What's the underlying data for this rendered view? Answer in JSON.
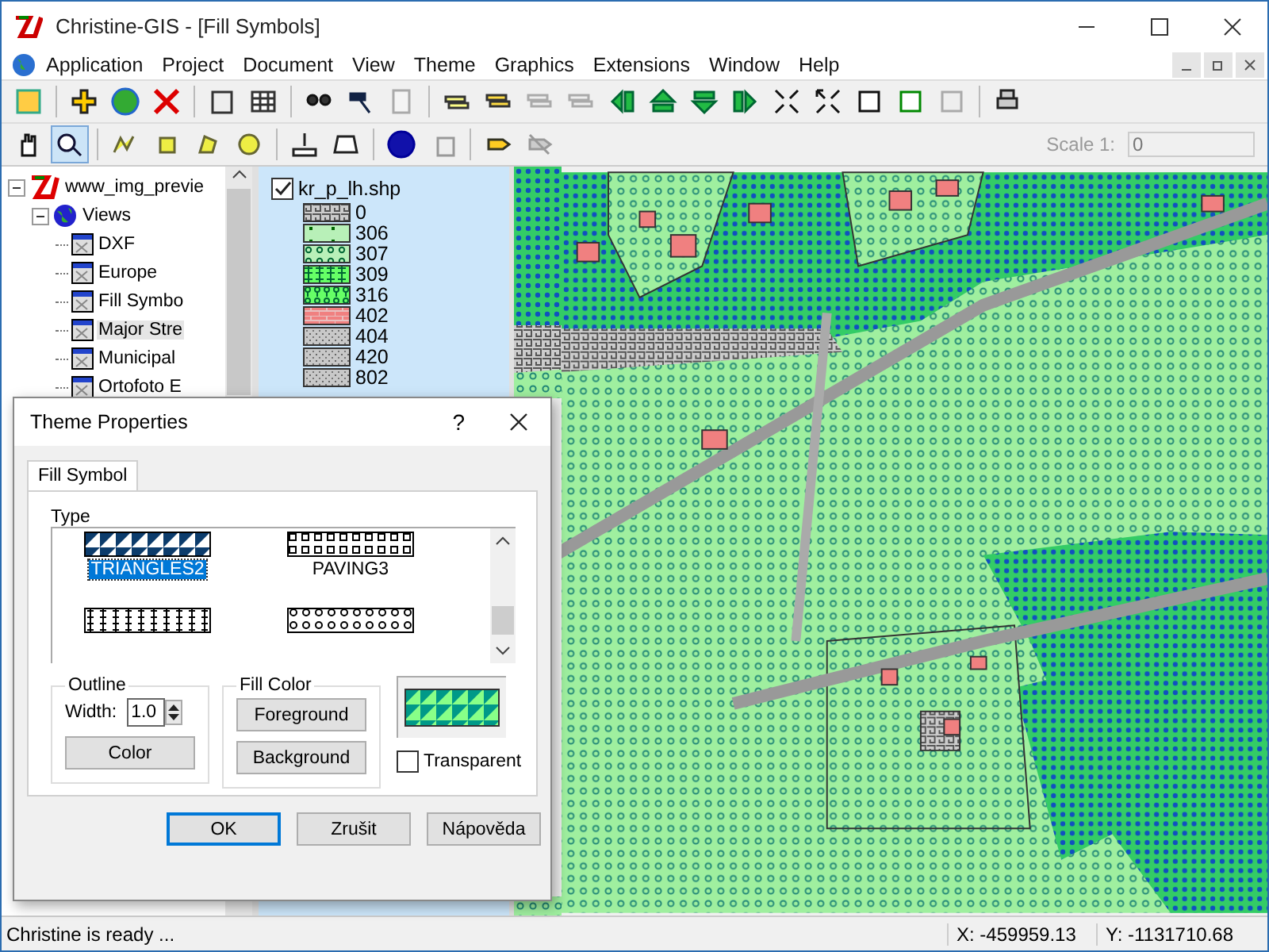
{
  "window": {
    "title": "Christine-GIS - [Fill Symbols]"
  },
  "menu": [
    "Application",
    "Project",
    "Document",
    "View",
    "Theme",
    "Graphics",
    "Extensions",
    "Window",
    "Help"
  ],
  "scale": {
    "label": "Scale 1:",
    "value": "0",
    "disabled": true
  },
  "tree": [
    {
      "label": "www_img_previe",
      "kind": "project",
      "expanded": true,
      "selected": false,
      "children": [
        {
          "label": "Views",
          "kind": "folder",
          "expanded": true,
          "selected": false,
          "children": [
            {
              "label": "DXF",
              "kind": "view",
              "selected": false
            },
            {
              "label": "Europe",
              "kind": "view",
              "selected": false
            },
            {
              "label": "Fill Symbo",
              "kind": "view",
              "selected": false
            },
            {
              "label": "Major Stre",
              "kind": "view",
              "selected": true
            },
            {
              "label": "Municipal",
              "kind": "view",
              "selected": false
            },
            {
              "label": "Ortofoto E",
              "kind": "view",
              "selected": false
            }
          ]
        }
      ]
    }
  ],
  "legend": {
    "layer": "kr_p_lh.shp",
    "checked": true,
    "entries": [
      {
        "label": "0",
        "kind": "maze"
      },
      {
        "label": "306",
        "kind": "dots"
      },
      {
        "label": "307",
        "kind": "circles"
      },
      {
        "label": "309",
        "kind": "trees"
      },
      {
        "label": "316",
        "kind": "shrubs"
      },
      {
        "label": "402",
        "kind": "bricks"
      },
      {
        "label": "404",
        "kind": "stipple"
      },
      {
        "label": "420",
        "kind": "stipple"
      },
      {
        "label": "802",
        "kind": "stipple"
      }
    ]
  },
  "dialog": {
    "title": "Theme Properties",
    "help": "?",
    "tabs": [
      {
        "label": "Fill Symbol",
        "selected": true
      }
    ],
    "type_label": "Type",
    "symbols": [
      {
        "label": "TRIANGLES2",
        "kind": "triangles",
        "selected": true
      },
      {
        "label": "PAVING3",
        "kind": "paving",
        "selected": false
      },
      {
        "kind": "tree1",
        "selected": false
      },
      {
        "kind": "tree2",
        "selected": false
      }
    ],
    "outline": {
      "title": "Outline",
      "width_label": "Width:",
      "width_value": "1.0",
      "button": "Color"
    },
    "fill_color": {
      "title": "Fill Color",
      "buttons": [
        "Foreground",
        "Background"
      ]
    },
    "transparent": {
      "label": "Transparent",
      "checked": false
    },
    "buttons": [
      {
        "label": "OK",
        "default": true
      },
      {
        "label": "Zrušit",
        "default": false
      },
      {
        "label": "Nápověda",
        "default": false
      }
    ]
  },
  "status_bar": {
    "message": "Christine is ready ...",
    "x": "X: -459959.13",
    "y": "Y: -1131710.68"
  }
}
